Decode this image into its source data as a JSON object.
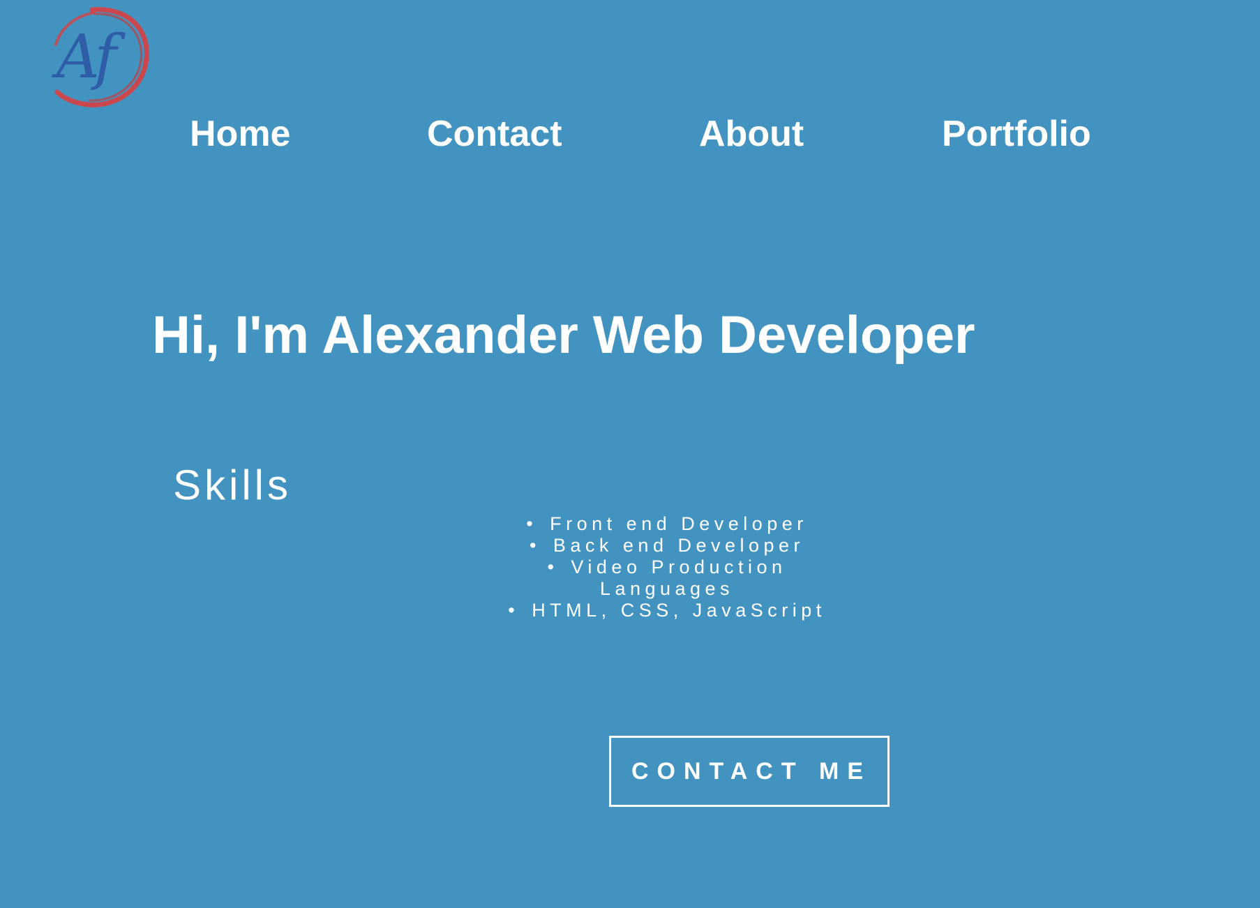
{
  "brand": {
    "logo_text": "Af",
    "logo_ring_color": "#d94040",
    "logo_letter_color": "#2f5da8"
  },
  "nav": {
    "items": [
      {
        "label": "Home"
      },
      {
        "label": "Contact"
      },
      {
        "label": "About"
      },
      {
        "label": "Portfolio"
      }
    ]
  },
  "hero": {
    "title": "Hi, I'm Alexander Web Developer"
  },
  "skills": {
    "heading": "Skills",
    "bullet": "•",
    "items": [
      "Front end Developer",
      "Back end Developer",
      "Video Production"
    ],
    "languages_label": "Languages",
    "languages": "HTML, CSS, JavaScript"
  },
  "cta": {
    "label": "CONTACT ME"
  },
  "colors": {
    "background": "#4393c1",
    "text": "#ffffff"
  }
}
